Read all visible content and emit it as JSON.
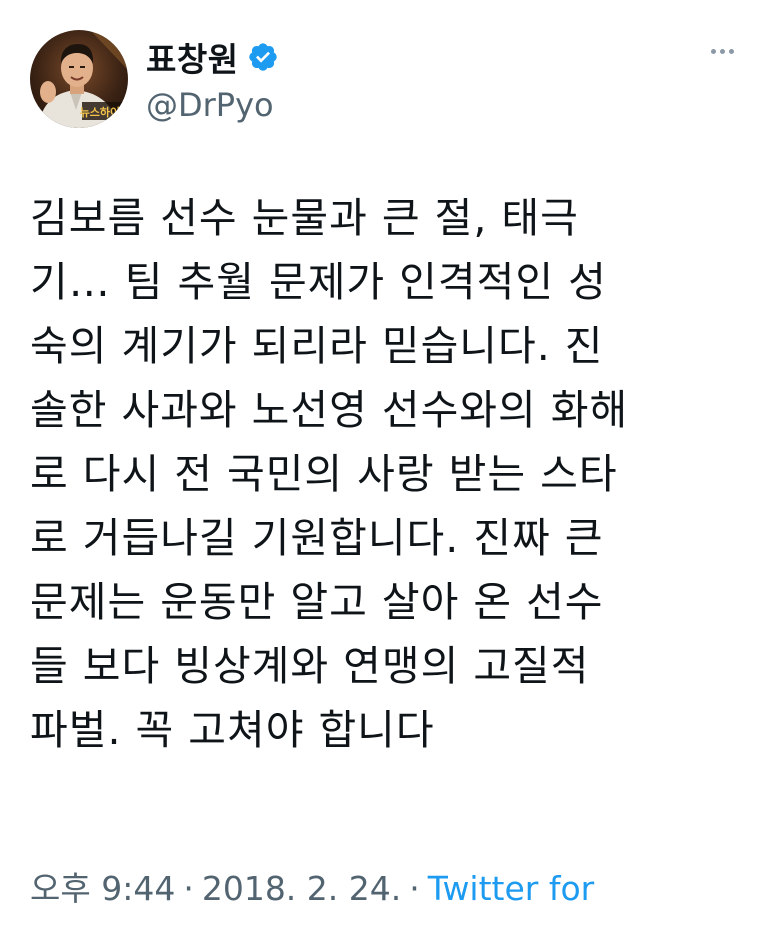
{
  "author": {
    "display_name": "표창원",
    "handle": "@DrPyo",
    "avatar_badge_text": "뉴스하이킥",
    "verified_icon": "verified-badge-icon",
    "verified_color": "#1d9bf0"
  },
  "more_icon": "more-horizontal-icon",
  "tweet": {
    "lines": [
      "김보름 선수 눈물과 큰 절, 태극",
      "기… 팀 추월 문제가 인격적인 성",
      "숙의 계기가 되리라 믿습니다. 진",
      "솔한 사과와 노선영 선수와의 화해",
      "로 다시 전 국민의 사랑 받는 스타",
      "로 거듭나길 기원합니다.  진짜 큰",
      "문제는 운동만 알고 살아 온 선수",
      "들 보다 빙상계와 연맹의 고질적",
      "파벌. 꼭 고쳐야 합니다"
    ]
  },
  "meta": {
    "time": "오후 9:44",
    "separator": "·",
    "date": "2018. 2. 24.",
    "source": "Twitter for",
    "link_color": "#1d9bf0"
  }
}
